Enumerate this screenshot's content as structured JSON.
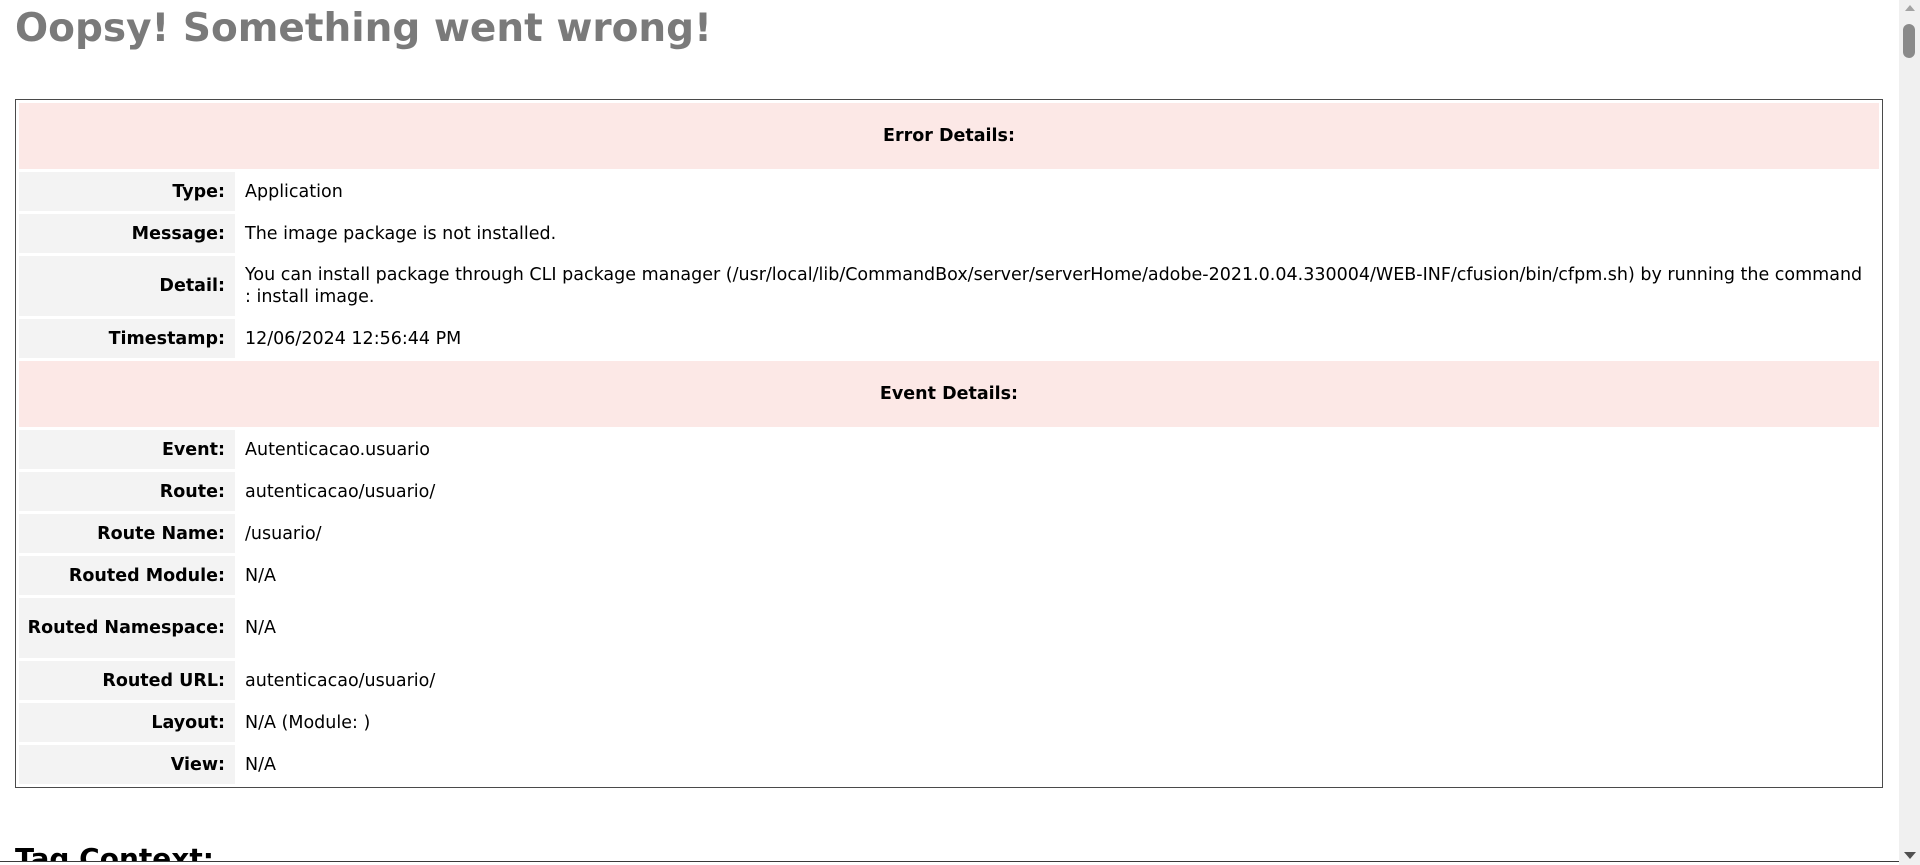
{
  "page": {
    "title": "Oopsy! Something went wrong!",
    "next_heading": "Tag Context:"
  },
  "error_section": {
    "header": "Error Details:",
    "rows": [
      {
        "label": "Type:",
        "value": "Application"
      },
      {
        "label": "Message:",
        "value": "The image package is not installed."
      },
      {
        "label": "Detail:",
        "value": "You can install package through CLI package manager (/usr/local/lib/CommandBox/server/serverHome/adobe-2021.0.04.330004/WEB-INF/cfusion/bin/cfpm.sh) by running the command : install image."
      },
      {
        "label": "Timestamp:",
        "value": "12/06/2024 12:56:44 PM"
      }
    ]
  },
  "event_section": {
    "header": "Event Details:",
    "rows": [
      {
        "label": "Event:",
        "value": "Autenticacao.usuario"
      },
      {
        "label": "Route:",
        "value": "autenticacao/usuario/"
      },
      {
        "label": "Route Name:",
        "value": "/usuario/"
      },
      {
        "label": "Routed Module:",
        "value": "N/A"
      },
      {
        "label": "Routed Namespace:",
        "value": "N/A"
      },
      {
        "label": "Routed URL:",
        "value": "autenticacao/usuario/"
      },
      {
        "label": "Layout:",
        "value": "N/A (Module: )"
      },
      {
        "label": "View:",
        "value": "N/A"
      }
    ]
  },
  "colors": {
    "title": "#7a7a7a",
    "section_header_bg": "#fce8e6",
    "label_bg": "#f3f3f3"
  }
}
